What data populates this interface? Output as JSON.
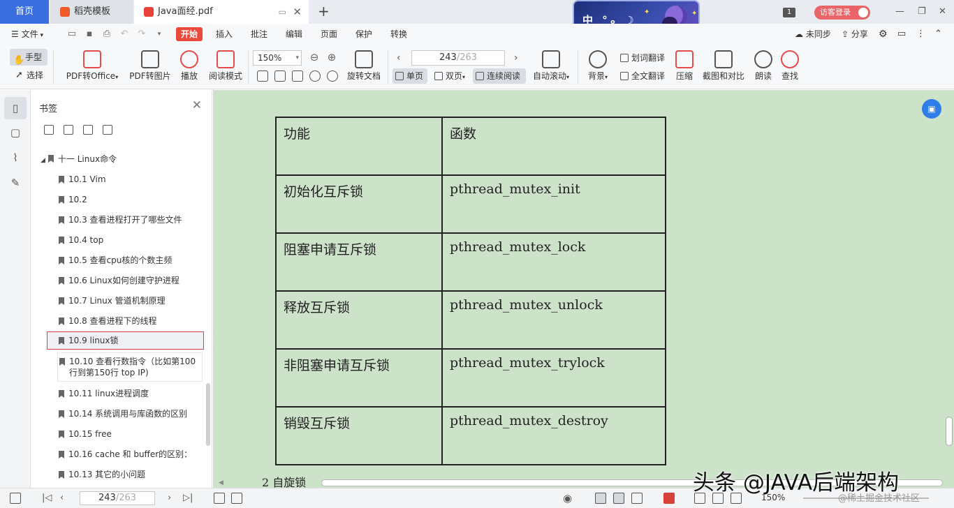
{
  "tabs": {
    "home": "首页",
    "template": "稻壳模板",
    "file": "Java面经.pdf",
    "add": "+"
  },
  "banner": {
    "text": "中 °ₒ ☽"
  },
  "account": {
    "badge": "1",
    "login": "访客登录"
  },
  "window_controls": {
    "minimize": "—",
    "restore": "❐",
    "close": "✕"
  },
  "menu": {
    "file": "文件",
    "items": [
      "开始",
      "插入",
      "批注",
      "编辑",
      "页面",
      "保护",
      "转换"
    ],
    "right": {
      "sync": "未同步",
      "share": "分享"
    }
  },
  "ribbon": {
    "hand": "手型",
    "select": "选择",
    "pdf_to_office": "PDF转Office",
    "pdf_to_image": "PDF转图片",
    "play": "播放",
    "read_mode": "阅读模式",
    "zoom": "150%",
    "rotate": "旋转文档",
    "page_current": "243",
    "page_total": "/263",
    "single_page": "单页",
    "double_page": "双页",
    "continuous": "连续阅读",
    "auto_scroll": "自动滚动",
    "background": "背景",
    "word_translate": "划词翻译",
    "full_translate": "全文翻译",
    "compress": "压缩",
    "screenshot_compare": "截图和对比",
    "read_aloud": "朗读",
    "find": "查找"
  },
  "bookmarks": {
    "title": "书签",
    "root": "十一 Linux命令",
    "items": [
      "10.1 Vim",
      "10.2",
      "10.3 查看进程打开了哪些文件",
      "10.4 top",
      "10.5 查看cpu核的个数主频",
      "10.6 Linux如何创建守护进程",
      "10.7 Linux 管道机制原理",
      "10.8 查看进程下的线程",
      "10.9 linux锁",
      "10.10 查看行数指令（比如第100行到第150行 top IP)",
      "10.11 linux进程调度",
      "10.14 系统调用与库函数的区别",
      "10.15 free",
      " 10.16 cache 和 buffer的区别：",
      "10.13 其它的小问题"
    ],
    "selected_index": 8
  },
  "document": {
    "table": {
      "headers": [
        "功能",
        "函数"
      ],
      "rows": [
        [
          "初始化互斥锁",
          "pthread_mutex_init"
        ],
        [
          "阻塞申请互斥锁",
          "pthread_mutex_lock"
        ],
        [
          "释放互斥锁",
          "pthread_mutex_unlock"
        ],
        [
          "非阻塞申请互斥锁",
          "pthread_mutex_trylock"
        ],
        [
          "销毁互斥锁",
          "pthread_mutex_destroy"
        ]
      ]
    },
    "bottom_text": "2 自旋锁"
  },
  "status": {
    "page_current": "243",
    "page_total": "/263",
    "zoom": "150%"
  },
  "watermark": {
    "main": "头条 @JAVA后端架构",
    "sub": "@稀土掘金技术社区"
  },
  "colors": {
    "accent_red": "#e94a3b",
    "home_tab_blue": "#3b6fe0",
    "doc_background": "#cce2c9"
  }
}
